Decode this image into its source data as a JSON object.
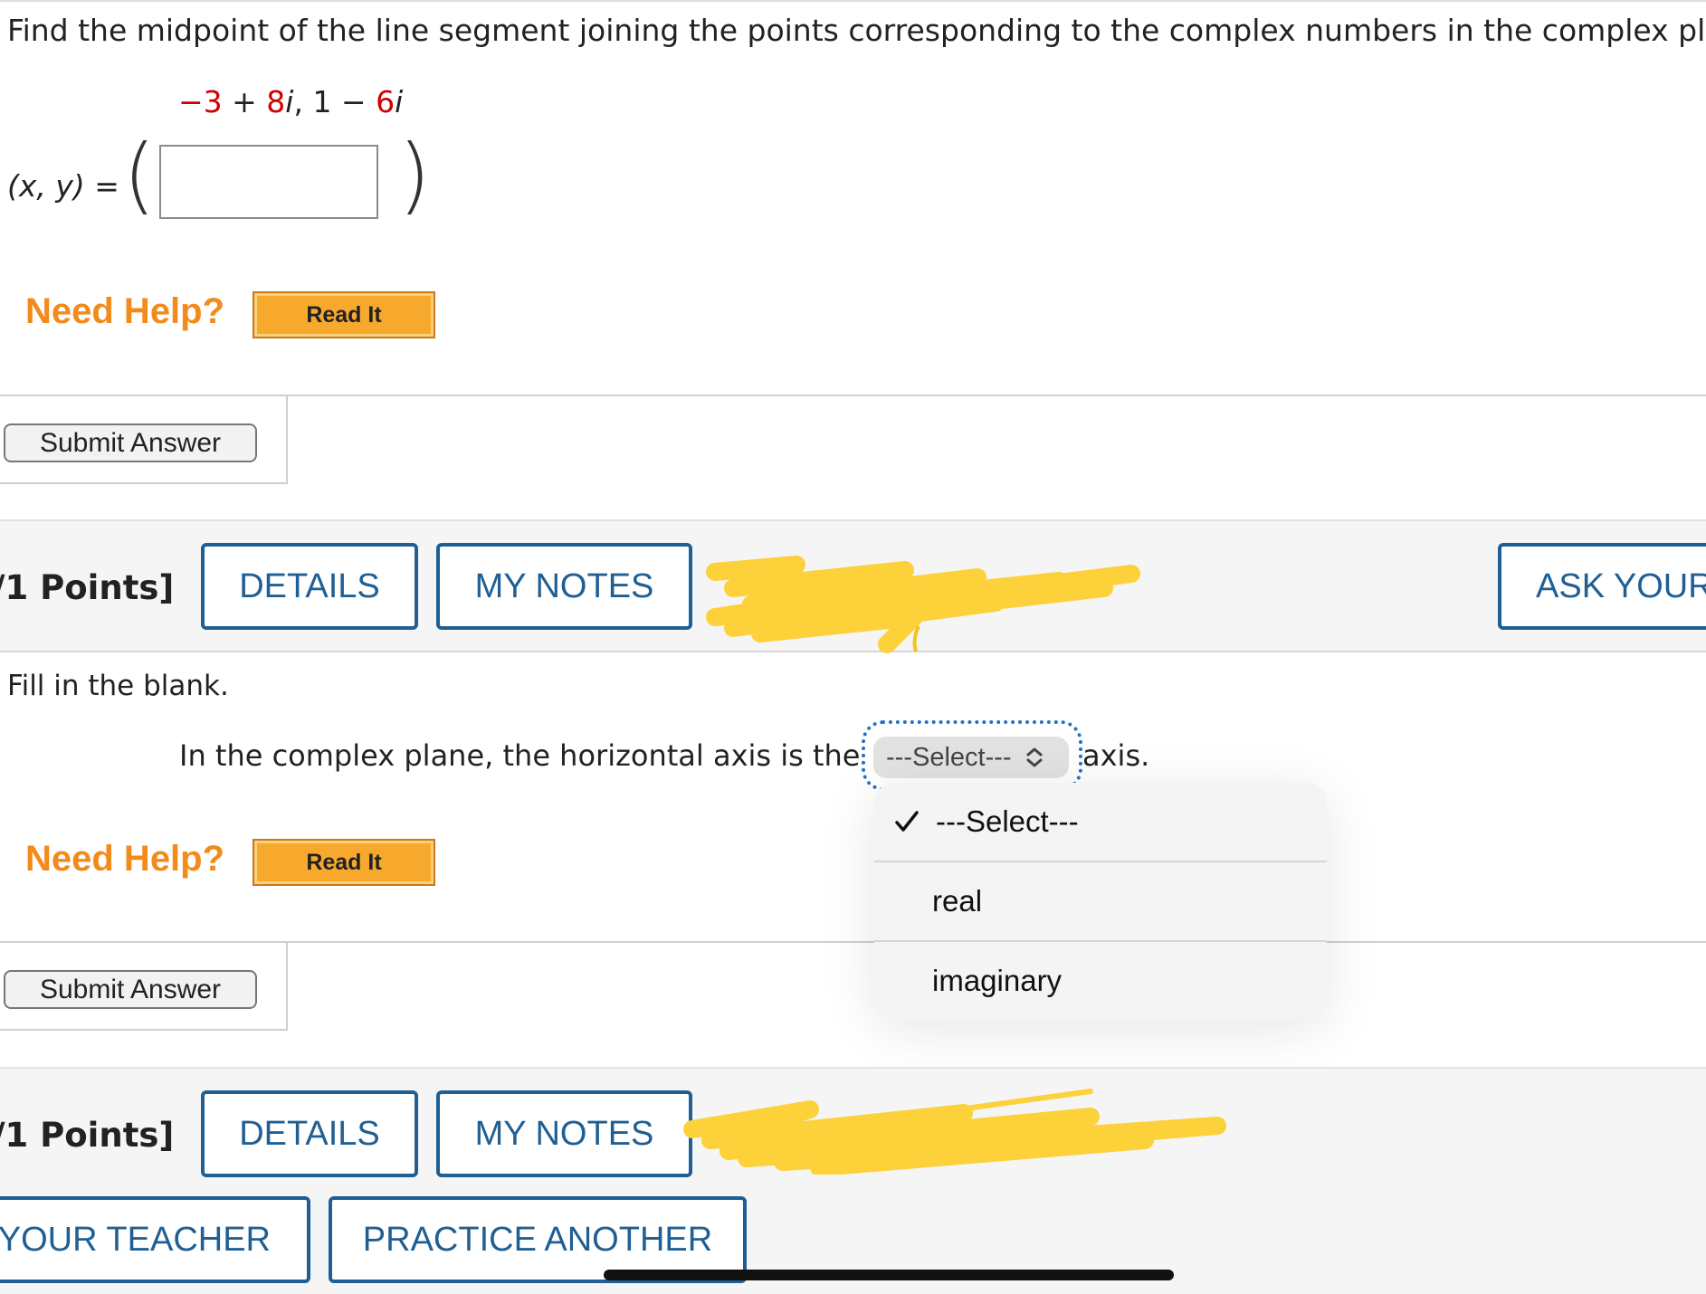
{
  "question1": {
    "prompt": "Find the midpoint of the line segment joining the points corresponding to the complex numbers in the complex plane.",
    "expr": {
      "a_re": "−3",
      "plus": " + ",
      "a_im": "8",
      "i1": "i",
      "sep": ", 1 − ",
      "b_im": "6",
      "i2": "i"
    },
    "answer_label": "(x, y) =",
    "answer_value": ""
  },
  "help": {
    "label": "Need Help?",
    "read_it": "Read It"
  },
  "submit_label": "Submit Answer",
  "question2": {
    "points": "/1 Points]",
    "details": "DETAILS",
    "my_notes": "MY NOTES",
    "ask_teacher": "ASK YOUR",
    "instruction": "Fill in the blank.",
    "sentence_before": "In the complex plane, the horizontal axis is the",
    "sentence_after": "axis.",
    "select_value": "---Select---",
    "options": [
      {
        "label": "---Select---",
        "checked": true
      },
      {
        "label": "real",
        "checked": false
      },
      {
        "label": "imaginary",
        "checked": false
      }
    ]
  },
  "question3": {
    "points": "/1 Points]",
    "details": "DETAILS",
    "my_notes": "MY NOTES",
    "ask_teacher": "YOUR TEACHER",
    "practice_another": "PRACTICE ANOTHER"
  },
  "colors": {
    "accent_blue": "#1f5f94",
    "help_orange": "#f28a1c",
    "complex_red": "#d00000",
    "redaction_yellow": "#fcd13a"
  }
}
